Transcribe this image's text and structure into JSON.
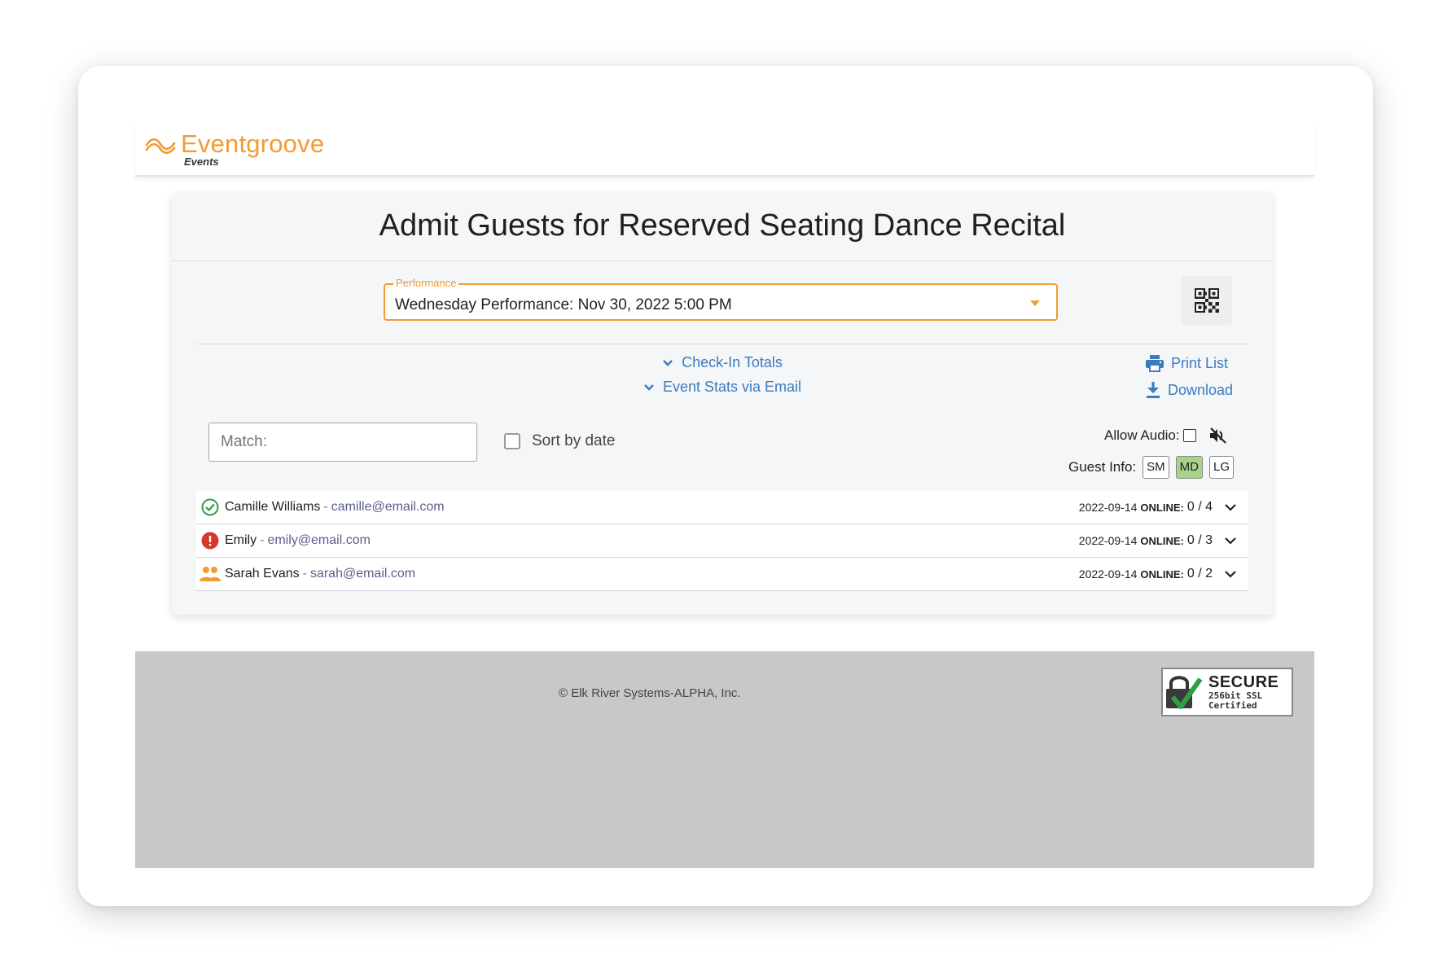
{
  "brand": {
    "name": "Eventgroove",
    "sub": "Events",
    "color": "#f39a33"
  },
  "page_title": "Admit Guests for Reserved Seating Dance Recital",
  "performance": {
    "legend": "Performance",
    "selected": "Wednesday Performance: Nov 30, 2022 5:00 PM"
  },
  "links": {
    "checkin_totals": "Check-In Totals",
    "event_stats": "Event Stats via Email",
    "print_list": "Print List",
    "download": "Download"
  },
  "filters": {
    "match_placeholder": "Match:",
    "sort_by_date": "Sort by date",
    "allow_audio": "Allow Audio:",
    "guest_info": "Guest Info:",
    "sizes": [
      "SM",
      "MD",
      "LG"
    ],
    "active_size": "MD"
  },
  "guests": [
    {
      "name": "Camille Williams",
      "sep": "-",
      "email": "camille@email.com",
      "date": "2022-09-14",
      "online_label": "ONLINE:",
      "count": "0 / 4",
      "status": "checked-in"
    },
    {
      "name": "Emily",
      "sep": "-",
      "email": "emily@email.com",
      "date": "2022-09-14",
      "online_label": "ONLINE:",
      "count": "0 / 3",
      "status": "alert"
    },
    {
      "name": "Sarah Evans",
      "sep": "-",
      "email": "sarah@email.com",
      "date": "2022-09-14",
      "online_label": "ONLINE:",
      "count": "0 / 2",
      "status": "group"
    }
  ],
  "footer": {
    "copyright": "© Elk River Systems-ALPHA, Inc.",
    "ssl_main": "SECURE",
    "ssl_line1": "256bit SSL",
    "ssl_line2": "Certified"
  }
}
